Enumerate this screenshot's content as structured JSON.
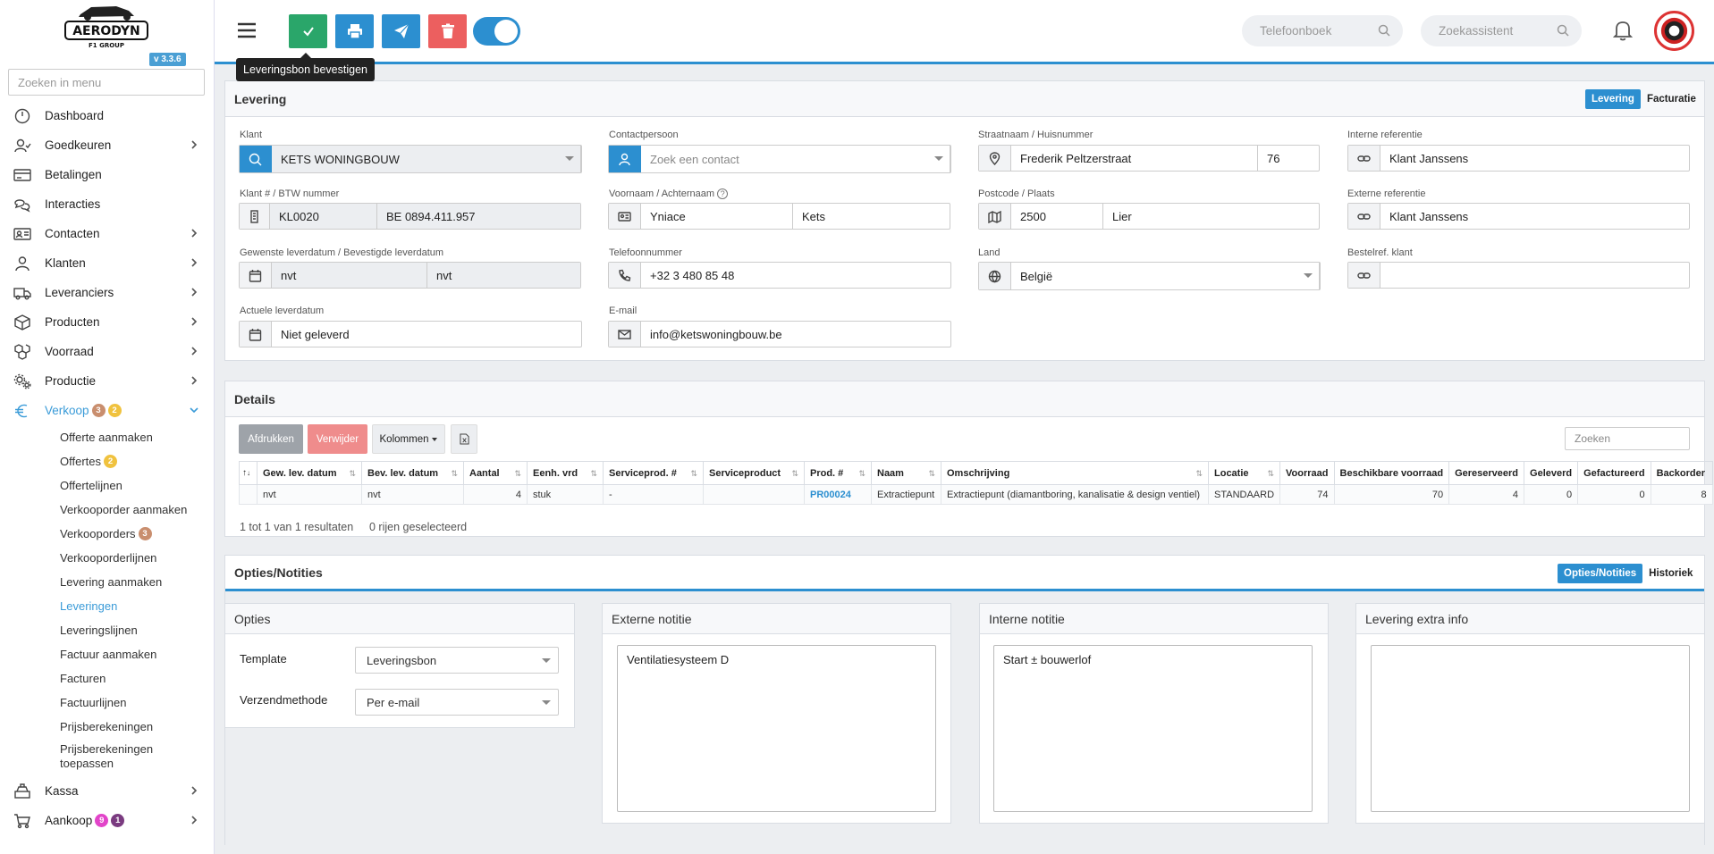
{
  "app": {
    "version": "v 3.3.6",
    "menu_search_placeholder": "Zoeken in menu",
    "logo_text": "AERODYN",
    "logo_sub": "F1 GROUP"
  },
  "sidebar": {
    "items": [
      {
        "label": "Dashboard"
      },
      {
        "label": "Goedkeuren"
      },
      {
        "label": "Betalingen"
      },
      {
        "label": "Interacties"
      },
      {
        "label": "Contacten"
      },
      {
        "label": "Klanten"
      },
      {
        "label": "Leveranciers"
      },
      {
        "label": "Producten"
      },
      {
        "label": "Voorraad"
      },
      {
        "label": "Productie"
      },
      {
        "label": "Verkoop",
        "badge1": "3",
        "badge2": "2"
      },
      {
        "label": "Kassa"
      },
      {
        "label": "Aankoop",
        "badge1": "9",
        "badge2": "1"
      }
    ],
    "sub_items": [
      {
        "label": "Offerte aanmaken"
      },
      {
        "label": "Offertes",
        "badge": "2"
      },
      {
        "label": "Offertelijnen"
      },
      {
        "label": "Verkooporder aanmaken"
      },
      {
        "label": "Verkooporders",
        "badge": "3"
      },
      {
        "label": "Verkooporderlijnen"
      },
      {
        "label": "Levering aanmaken"
      },
      {
        "label": "Leveringen"
      },
      {
        "label": "Leveringslijnen"
      },
      {
        "label": "Factuur aanmaken"
      },
      {
        "label": "Facturen"
      },
      {
        "label": "Factuurlijnen"
      },
      {
        "label": "Prijsberekeningen"
      },
      {
        "label": "Prijsberekeningen toepassen"
      }
    ]
  },
  "topbar": {
    "tooltip": "Leveringsbon bevestigen",
    "search1_placeholder": "Telefoonboek",
    "search2_placeholder": "Zoekassistent"
  },
  "levering": {
    "title": "Levering",
    "tab_on": "Levering",
    "tab_off": "Facturatie",
    "klant_label": "Klant",
    "klant_value": "KETS WONINGBOUW",
    "contact_label": "Contactpersoon",
    "contact_placeholder": "Zoek een contact",
    "straat_label": "Straatnaam / Huisnummer",
    "straat_value": "Frederik Peltzerstraat",
    "huisnr_value": "76",
    "intref_label": "Interne referentie",
    "intref_value": "Klant Janssens",
    "klantnr_label": "Klant # / BTW nummer",
    "klantnr_value": "KL0020",
    "btw_value": "BE 0894.411.957",
    "naam_label": "Voornaam / Achternaam",
    "voornaam_value": "Yniace",
    "achternaam_value": "Kets",
    "postcode_label": "Postcode / Plaats",
    "postcode_value": "2500",
    "plaats_value": "Lier",
    "extref_label": "Externe referentie",
    "extref_value": "Klant Janssens",
    "gewenst_label": "Gewenste leverdatum / Bevestigde leverdatum",
    "gewenst_value": "nvt",
    "bevestigd_value": "nvt",
    "tel_label": "Telefoonnummer",
    "tel_value": "+32 3 480 85 48",
    "land_label": "Land",
    "land_value": "België",
    "bestelref_label": "Bestelref. klant",
    "bestelref_value": "",
    "actueel_label": "Actuele leverdatum",
    "actueel_value": "Niet geleverd",
    "email_label": "E-mail",
    "email_value": "info@ketswoningbouw.be"
  },
  "details": {
    "title": "Details",
    "btn_print": "Afdrukken",
    "btn_delete": "Verwijder",
    "btn_columns": "Kolommen",
    "search_placeholder": "Zoeken",
    "columns": [
      "Gew. lev. datum",
      "Bev. lev. datum",
      "Aantal",
      "Eenh. vrd",
      "Serviceprod. #",
      "Serviceproduct",
      "Prod. #",
      "Naam",
      "Omschrijving",
      "Locatie",
      "Voorraad",
      "Beschikbare voorraad",
      "Gereserveerd",
      "Geleverd",
      "Gefactureerd",
      "Backorder"
    ],
    "rows": [
      [
        "nvt",
        "nvt",
        "4",
        "stuk",
        "-",
        "",
        "PR00024",
        "Extractiepunt",
        "Extractiepunt (diamantboring, kanalisatie & design ventiel)",
        "STANDAARD",
        "74",
        "70",
        "4",
        "0",
        "0",
        "8"
      ]
    ],
    "footer_results": "1 tot 1 van 1 resultaten",
    "footer_selected": "0 rijen geselecteerd"
  },
  "opties": {
    "title": "Opties/Notities",
    "tab_on": "Opties/Notities",
    "tab_off": "Historiek",
    "opties_title": "Opties",
    "template_label": "Template",
    "template_value": "Leveringsbon",
    "verzend_label": "Verzendmethode",
    "verzend_value": "Per e-mail",
    "extern_title": "Externe notitie",
    "extern_value": "Ventilatiesysteem D",
    "intern_title": "Interne notitie",
    "intern_value": "Start ± bouwerlof",
    "extra_title": "Levering extra info",
    "extra_value": ""
  },
  "colors": {
    "accent": "#2c8fd0",
    "success": "#2aa66a",
    "danger": "#ec5f5f"
  }
}
